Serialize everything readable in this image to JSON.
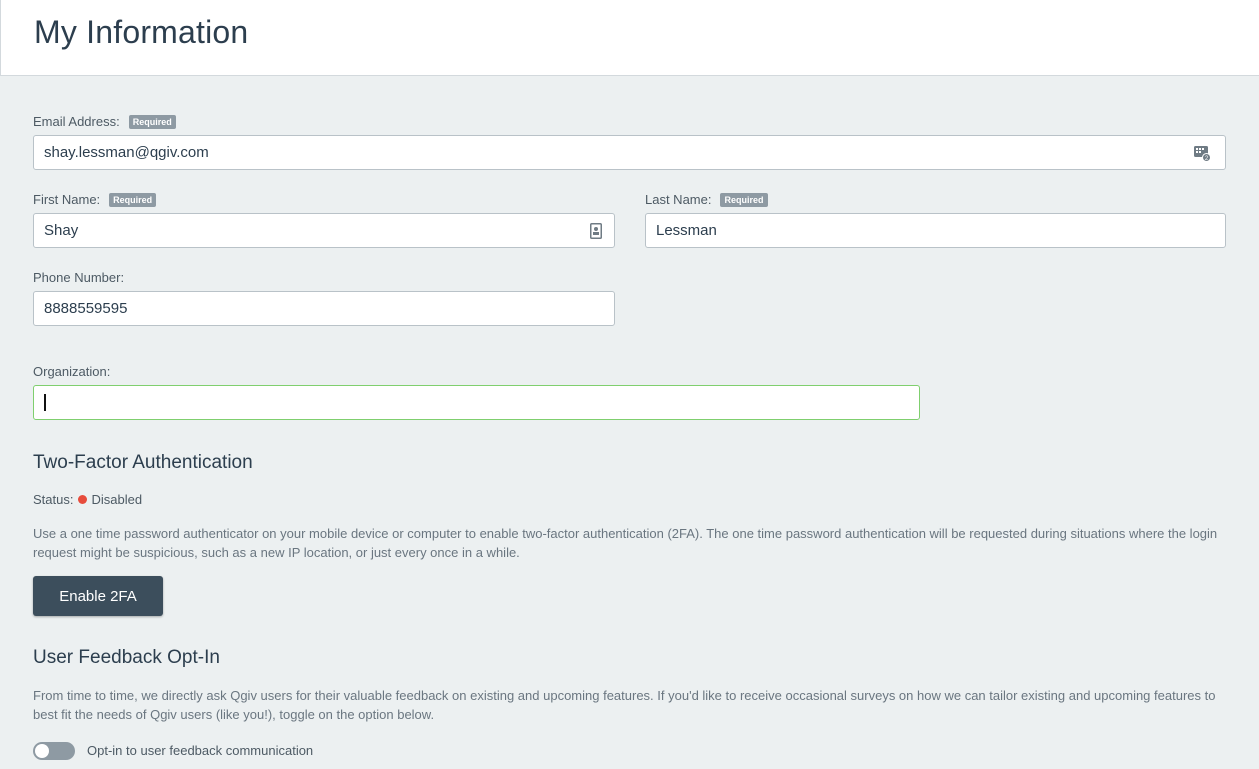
{
  "header": {
    "title": "My Information"
  },
  "form": {
    "email": {
      "label": "Email Address:",
      "badge": "Required",
      "value": "shay.lessman@qgiv.com",
      "icon": "contact-card-icon"
    },
    "first_name": {
      "label": "First Name:",
      "badge": "Required",
      "value": "Shay",
      "icon": "id-card-icon"
    },
    "last_name": {
      "label": "Last Name:",
      "badge": "Required",
      "value": "Lessman"
    },
    "phone": {
      "label": "Phone Number:",
      "value": "8888559595"
    },
    "organization": {
      "label": "Organization:",
      "value": ""
    }
  },
  "two_factor": {
    "title": "Two-Factor Authentication",
    "status_label": "Status:",
    "status_value": "Disabled",
    "status_color": "#e74c3c",
    "description": "Use a one time password authenticator on your mobile device or computer to enable two-factor authentication (2FA). The one time password authentication will be requested during situations where the login request might be suspicious, such as a new IP location, or just every once in a while.",
    "button_label": "Enable 2FA"
  },
  "feedback": {
    "title": "User Feedback Opt-In",
    "description": "From time to time, we directly ask Qgiv users for their valuable feedback on existing and upcoming features. If you'd like to receive occasional surveys on how we can tailor existing and upcoming features to best fit the needs of Qgiv users (like you!), toggle on the option below.",
    "toggle_label": "Opt-in to user feedback communication",
    "toggle_on": false
  },
  "colors": {
    "accent_dark": "#3c4e5c",
    "focus_border": "#7fcf6e",
    "badge_bg": "#8e9aa3",
    "page_bg": "#ecf0f1"
  }
}
